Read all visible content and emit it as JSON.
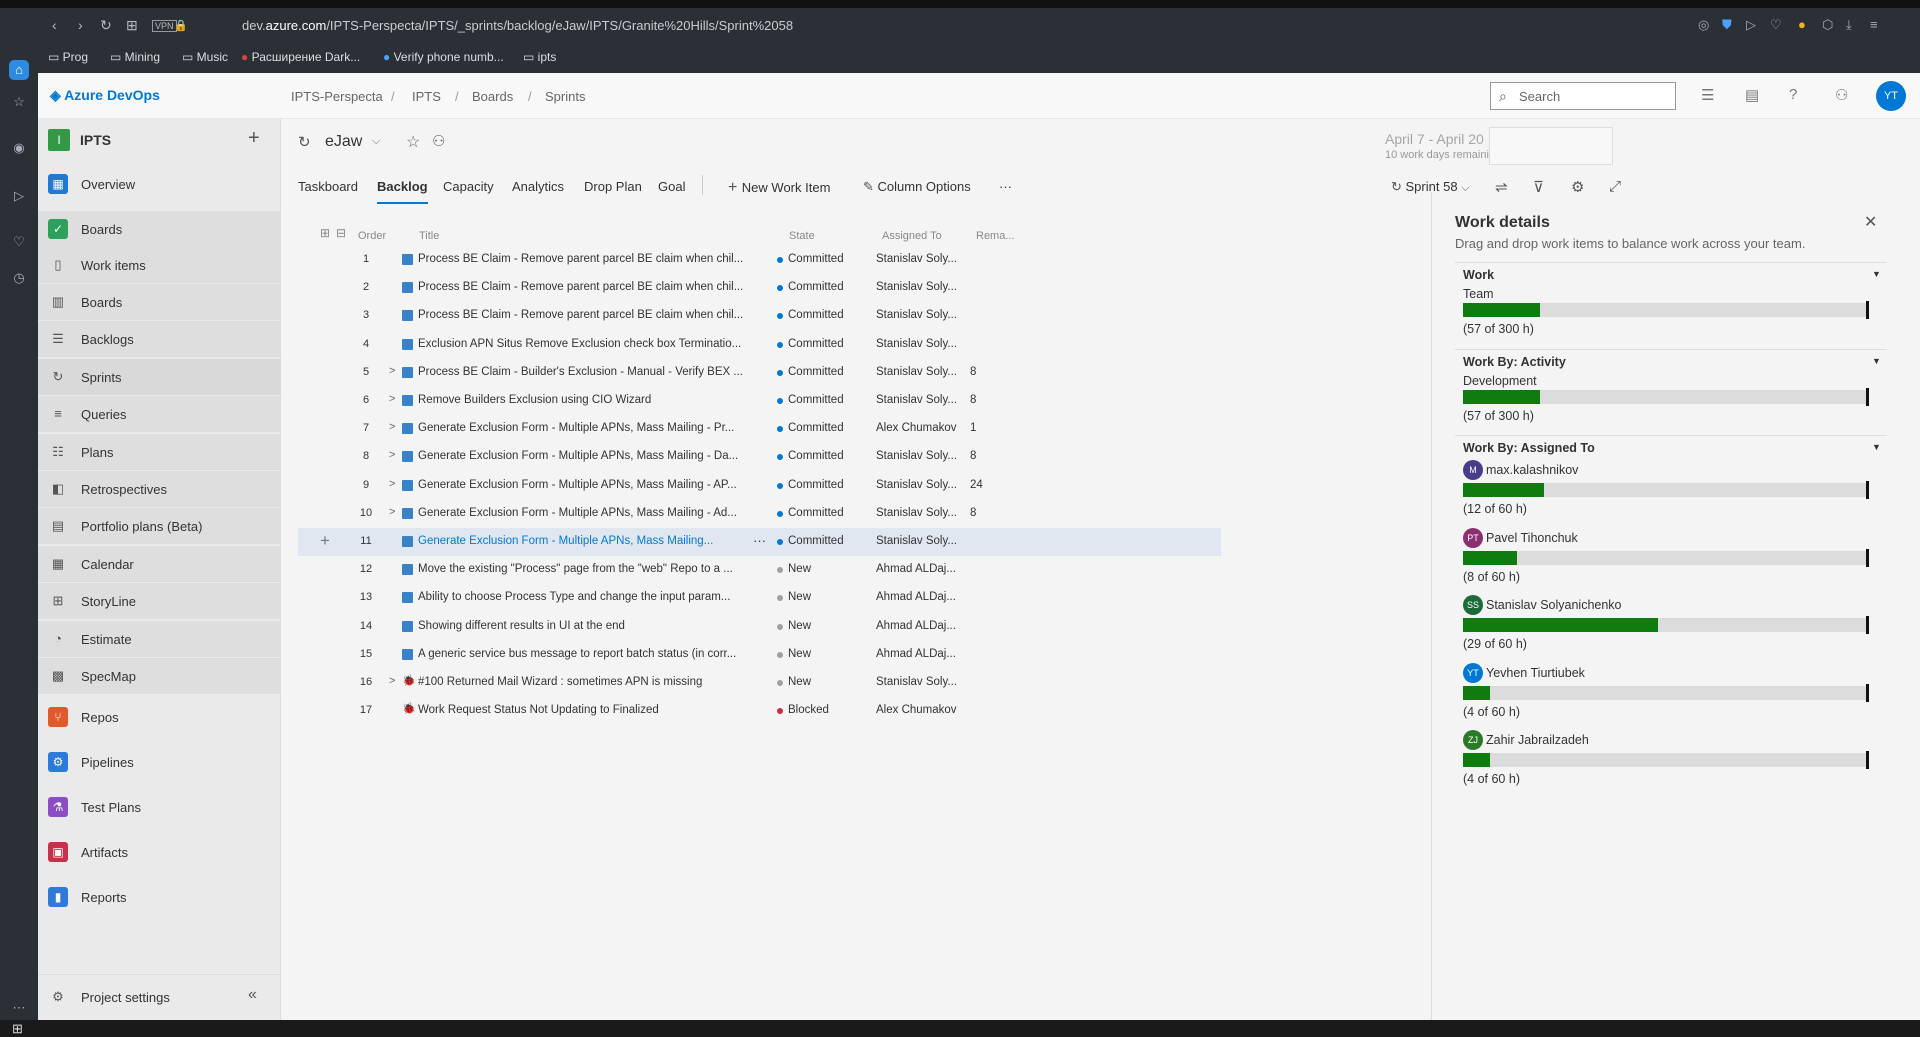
{
  "browser": {
    "url_prefix": "dev.",
    "url_host": "azure.com",
    "url_path": "/IPTS-Perspecta/IPTS/_sprints/backlog/eJaw/IPTS/Granite%20Hills/Sprint%2058",
    "vpn_label": "VPN",
    "bookmarks": [
      "Prog",
      "Mining",
      "Music",
      "Расширение Dark...",
      "Verify phone numb...",
      "ipts"
    ]
  },
  "header": {
    "product": "Azure DevOps",
    "breadcrumb": [
      "IPTS-Perspecta",
      "IPTS",
      "Boards",
      "Sprints"
    ],
    "search_placeholder": "Search",
    "avatar_initials": "YT"
  },
  "sidebar": {
    "project_initial": "I",
    "project_name": "IPTS",
    "items": [
      {
        "label": "Overview",
        "icon": "overview-icon",
        "color": "#1f7ad6"
      },
      {
        "label": "Boards",
        "icon": "boards-icon",
        "color": "#2ea05b"
      },
      {
        "label": "Work items",
        "icon": "work-items-icon"
      },
      {
        "label": "Boards",
        "icon": "board-icon"
      },
      {
        "label": "Backlogs",
        "icon": "backlogs-icon"
      },
      {
        "label": "Sprints",
        "icon": "sprints-icon"
      },
      {
        "label": "Queries",
        "icon": "queries-icon"
      },
      {
        "label": "Plans",
        "icon": "plans-icon"
      },
      {
        "label": "Retrospectives",
        "icon": "retrospectives-icon"
      },
      {
        "label": "Portfolio plans (Beta)",
        "icon": "portfolio-icon"
      },
      {
        "label": "Calendar",
        "icon": "calendar-icon"
      },
      {
        "label": "StoryLine",
        "icon": "storyline-icon"
      },
      {
        "label": "Estimate",
        "icon": "estimate-icon"
      },
      {
        "label": "SpecMap",
        "icon": "specmap-icon"
      },
      {
        "label": "Repos",
        "icon": "repos-icon",
        "color": "#e05a2b"
      },
      {
        "label": "Pipelines",
        "icon": "pipelines-icon",
        "color": "#2d7ad8"
      },
      {
        "label": "Test Plans",
        "icon": "test-plans-icon",
        "color": "#8a4dc2"
      },
      {
        "label": "Artifacts",
        "icon": "artifacts-icon",
        "color": "#c4314b"
      },
      {
        "label": "Reports",
        "icon": "reports-icon",
        "color": "#2d7ad8"
      }
    ],
    "settings_label": "Project settings"
  },
  "team": {
    "name": "eJaw"
  },
  "sprint": {
    "dates": "April 7 - April 20",
    "remaining": "10 work days remaining",
    "name": "Sprint 58"
  },
  "tabs": [
    "Taskboard",
    "Backlog",
    "Capacity",
    "Analytics",
    "Drop Plan",
    "Goal"
  ],
  "toolbar": {
    "new_item": "New Work Item",
    "column_options": "Column Options",
    "more": "···"
  },
  "columns": {
    "order": "Order",
    "title": "Title",
    "state": "State",
    "assigned": "Assigned To",
    "remaining": "Rema..."
  },
  "rows": [
    {
      "order": "1",
      "expand": "",
      "type": "pbi",
      "title": "Process BE Claim - Remove parent parcel BE claim when chil...",
      "state": "Committed",
      "assigned": "Stanislav Soly...",
      "remaining": ""
    },
    {
      "order": "2",
      "expand": "",
      "type": "pbi",
      "title": "Process BE Claim - Remove parent parcel BE claim when chil...",
      "state": "Committed",
      "assigned": "Stanislav Soly...",
      "remaining": ""
    },
    {
      "order": "3",
      "expand": "",
      "type": "pbi",
      "title": "Process BE Claim - Remove parent parcel BE claim when chil...",
      "state": "Committed",
      "assigned": "Stanislav Soly...",
      "remaining": ""
    },
    {
      "order": "4",
      "expand": "",
      "type": "pbi",
      "title": "Exclusion APN Situs Remove Exclusion check box Terminatio...",
      "state": "Committed",
      "assigned": "Stanislav Soly...",
      "remaining": ""
    },
    {
      "order": "5",
      "expand": ">",
      "type": "pbi",
      "title": "Process BE Claim - Builder's Exclusion - Manual - Verify BEX ...",
      "state": "Committed",
      "assigned": "Stanislav Soly...",
      "remaining": "8"
    },
    {
      "order": "6",
      "expand": ">",
      "type": "pbi",
      "title": "Remove Builders Exclusion using CIO Wizard",
      "state": "Committed",
      "assigned": "Stanislav Soly...",
      "remaining": "8"
    },
    {
      "order": "7",
      "expand": ">",
      "type": "pbi",
      "title": "Generate Exclusion Form - Multiple APNs, Mass Mailing - Pr...",
      "state": "Committed",
      "assigned": "Alex Chumakov",
      "remaining": "1"
    },
    {
      "order": "8",
      "expand": ">",
      "type": "pbi",
      "title": "Generate Exclusion Form - Multiple APNs, Mass Mailing - Da...",
      "state": "Committed",
      "assigned": "Stanislav Soly...",
      "remaining": "8"
    },
    {
      "order": "9",
      "expand": ">",
      "type": "pbi",
      "title": "Generate Exclusion Form - Multiple APNs, Mass Mailing - AP...",
      "state": "Committed",
      "assigned": "Stanislav Soly...",
      "remaining": "24"
    },
    {
      "order": "10",
      "expand": ">",
      "type": "pbi",
      "title": "Generate Exclusion Form - Multiple APNs, Mass Mailing - Ad...",
      "state": "Committed",
      "assigned": "Stanislav Soly...",
      "remaining": "8"
    },
    {
      "order": "11",
      "expand": "",
      "type": "pbi",
      "title": "Generate Exclusion Form - Multiple APNs, Mass Mailing...",
      "state": "Committed",
      "assigned": "Stanislav Soly...",
      "remaining": "",
      "selected": true
    },
    {
      "order": "12",
      "expand": "",
      "type": "pbi",
      "title": "Move the existing \"Process\" page from the \"web\" Repo to a ...",
      "state": "New",
      "assigned": "Ahmad ALDaj...",
      "remaining": ""
    },
    {
      "order": "13",
      "expand": "",
      "type": "pbi",
      "title": "Ability to choose Process Type and change the input param...",
      "state": "New",
      "assigned": "Ahmad ALDaj...",
      "remaining": ""
    },
    {
      "order": "14",
      "expand": "",
      "type": "pbi",
      "title": "Showing different results in UI at the end",
      "state": "New",
      "assigned": "Ahmad ALDaj...",
      "remaining": ""
    },
    {
      "order": "15",
      "expand": "",
      "type": "pbi",
      "title": "A generic service bus message to report batch status (in corr...",
      "state": "New",
      "assigned": "Ahmad ALDaj...",
      "remaining": ""
    },
    {
      "order": "16",
      "expand": ">",
      "type": "bug",
      "title": "#100 Returned Mail Wizard : sometimes APN is missing",
      "state": "New",
      "assigned": "Stanislav Soly...",
      "remaining": ""
    },
    {
      "order": "17",
      "expand": "",
      "type": "bug",
      "title": "Work Request Status Not Updating to Finalized",
      "state": "Blocked",
      "assigned": "Alex Chumakov",
      "remaining": ""
    }
  ],
  "state_colors": {
    "Committed": "#0078d4",
    "New": "#a0a0a0",
    "Blocked": "#cc293d"
  },
  "details": {
    "title": "Work details",
    "subtitle": "Drag and drop work items to balance work across your team.",
    "work": {
      "heading": "Work",
      "label": "Team",
      "hours": "(57 of 300 h)",
      "fraction": 0.19
    },
    "activity": {
      "heading": "Work By: Activity",
      "label": "Development",
      "hours": "(57 of 300 h)",
      "fraction": 0.19
    },
    "assigned": {
      "heading": "Work By: Assigned To",
      "people": [
        {
          "name": "max.kalashnikov",
          "initials": "M",
          "color": "#4b3c8a",
          "hours": "(12 of 60 h)",
          "fraction": 0.2
        },
        {
          "name": "Pavel Tihonchuk",
          "initials": "PT",
          "color": "#8a2f6f",
          "hours": "(8 of 60 h)",
          "fraction": 0.133
        },
        {
          "name": "Stanislav Solyanichenko",
          "initials": "SS",
          "color": "#1e6b3a",
          "hours": "(29 of 60 h)",
          "fraction": 0.483
        },
        {
          "name": "Yevhen Tiurtiubek",
          "initials": "YT",
          "color": "#0078d4",
          "hours": "(4 of 60 h)",
          "fraction": 0.067
        },
        {
          "name": "Zahir Jabrailzadeh",
          "initials": "ZJ",
          "color": "#2a7a2a",
          "hours": "(4 of 60 h)",
          "fraction": 0.067
        }
      ]
    }
  }
}
